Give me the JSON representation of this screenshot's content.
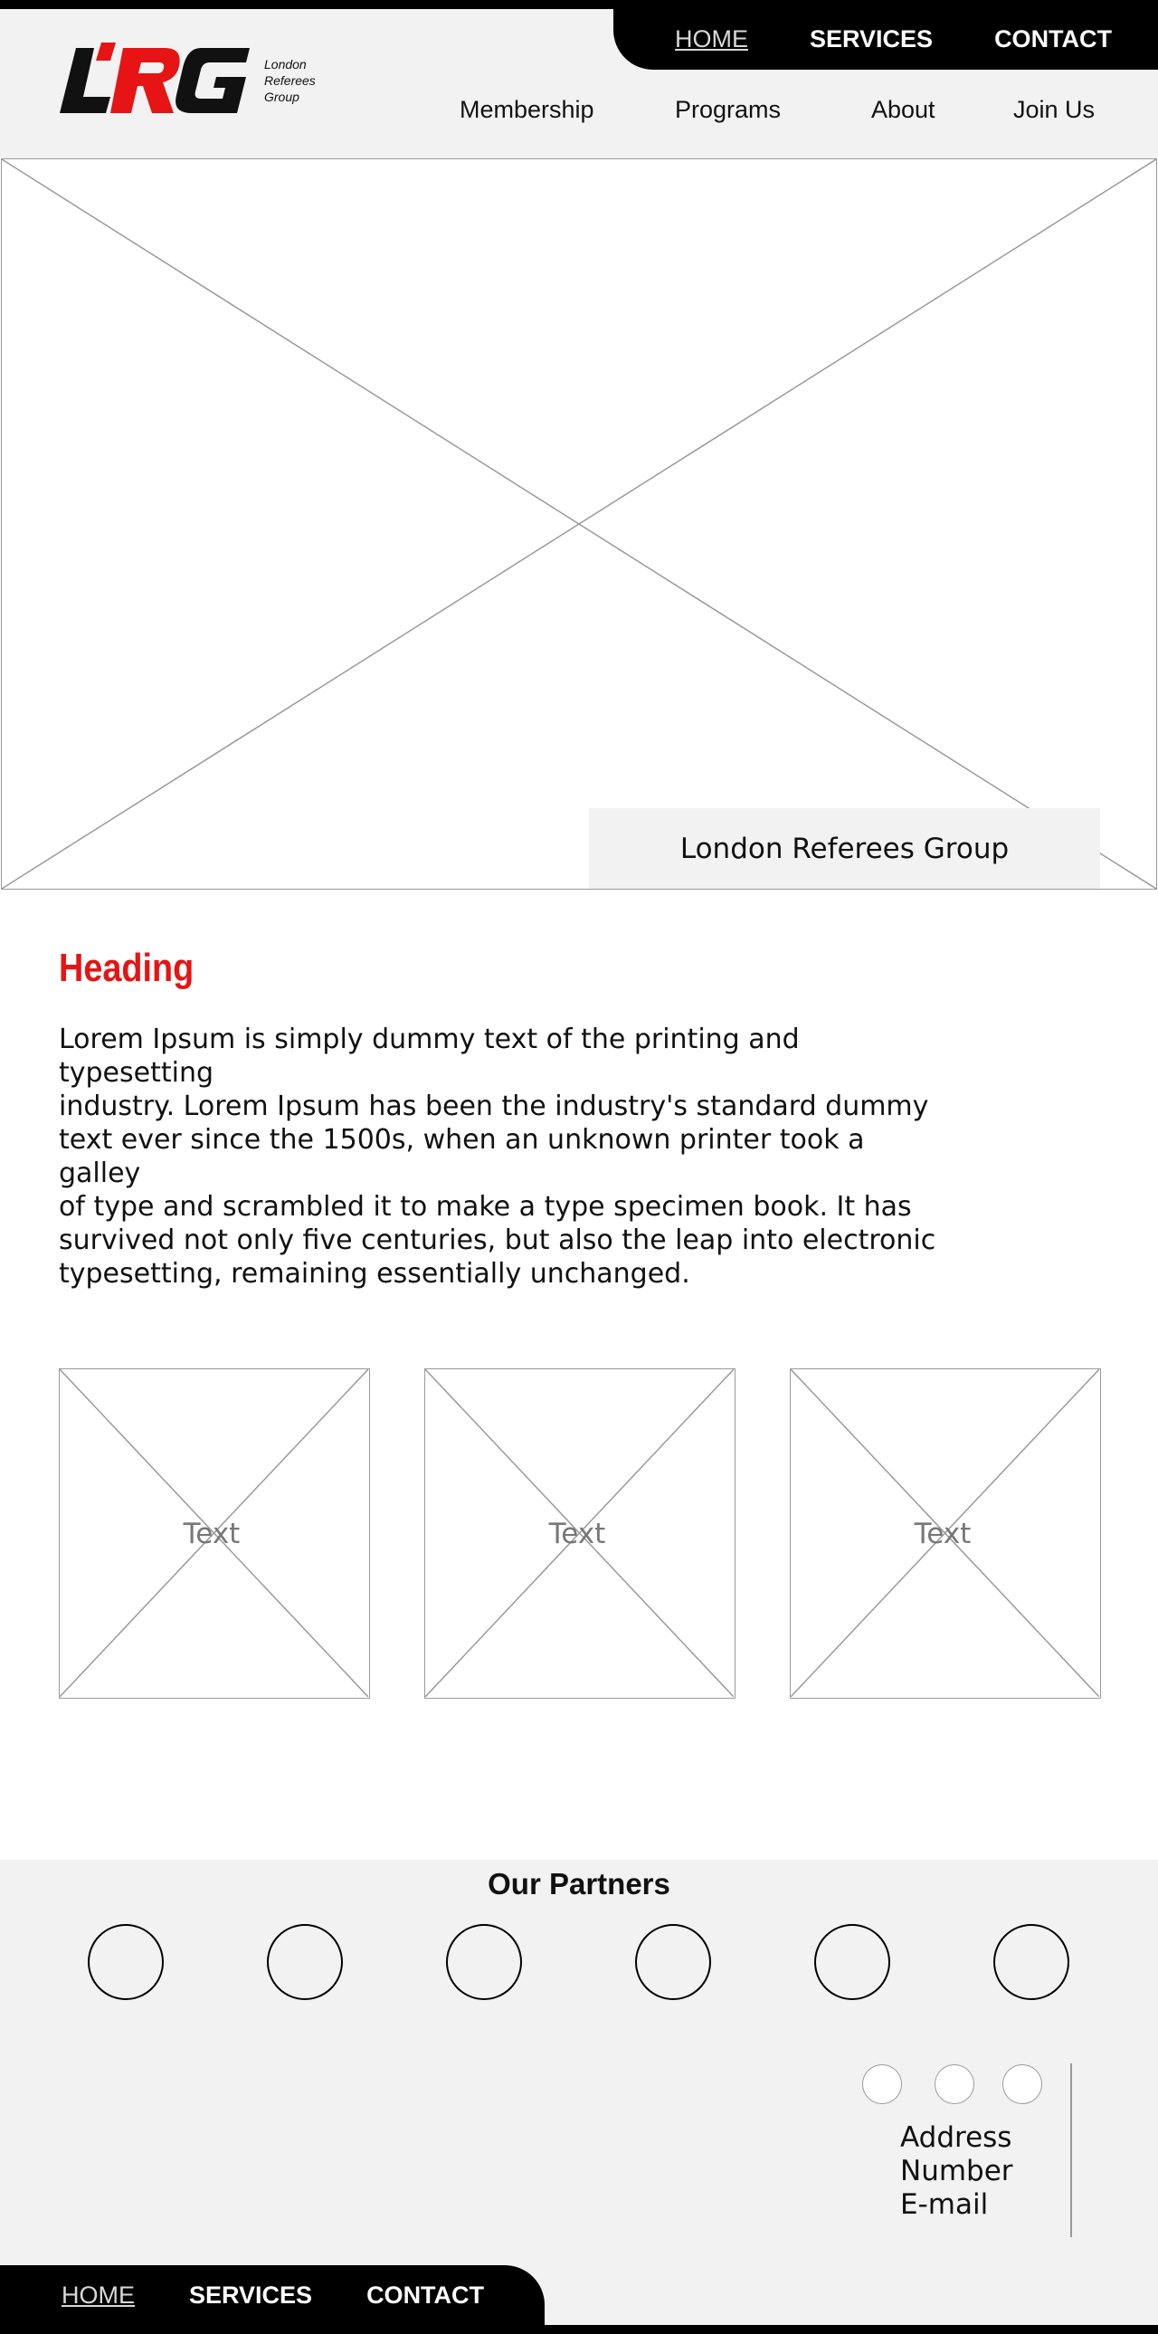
{
  "top_nav": {
    "home": "HOME",
    "services": "SERVICES",
    "contact": "CONTACT"
  },
  "logo": {
    "letters": "LRG",
    "sub_line1": "London",
    "sub_line2": "Referees",
    "sub_line3": "Group"
  },
  "main_nav": {
    "membership": "Membership",
    "programs": "Programs",
    "about": "About",
    "join": "Join Us"
  },
  "hero": {
    "caption": "London Referees Group"
  },
  "content": {
    "heading": "Heading",
    "paragraph": "Lorem Ipsum is simply dummy text of the printing and typesetting\n industry. Lorem Ipsum has been the industry's standard dummy\ntext ever since the 1500s, when an unknown printer took a galley\nof type and scrambled it to make a type specimen book. It has\nsurvived not only five centuries, but also the leap into electronic\ntypesetting, remaining essentially unchanged."
  },
  "cards": [
    {
      "text": "Text"
    },
    {
      "text": "Text"
    },
    {
      "text": "Text"
    }
  ],
  "partners": {
    "title": "Our Partners"
  },
  "contact": {
    "address": "Address",
    "number": "Number",
    "email": "E-mail"
  },
  "bottom_nav": {
    "home": "HOME",
    "services": "SERVICES",
    "contact": "CONTACT"
  },
  "colors": {
    "accent": "#e61414",
    "dark": "#000000",
    "panel": "#f2f2f2"
  }
}
